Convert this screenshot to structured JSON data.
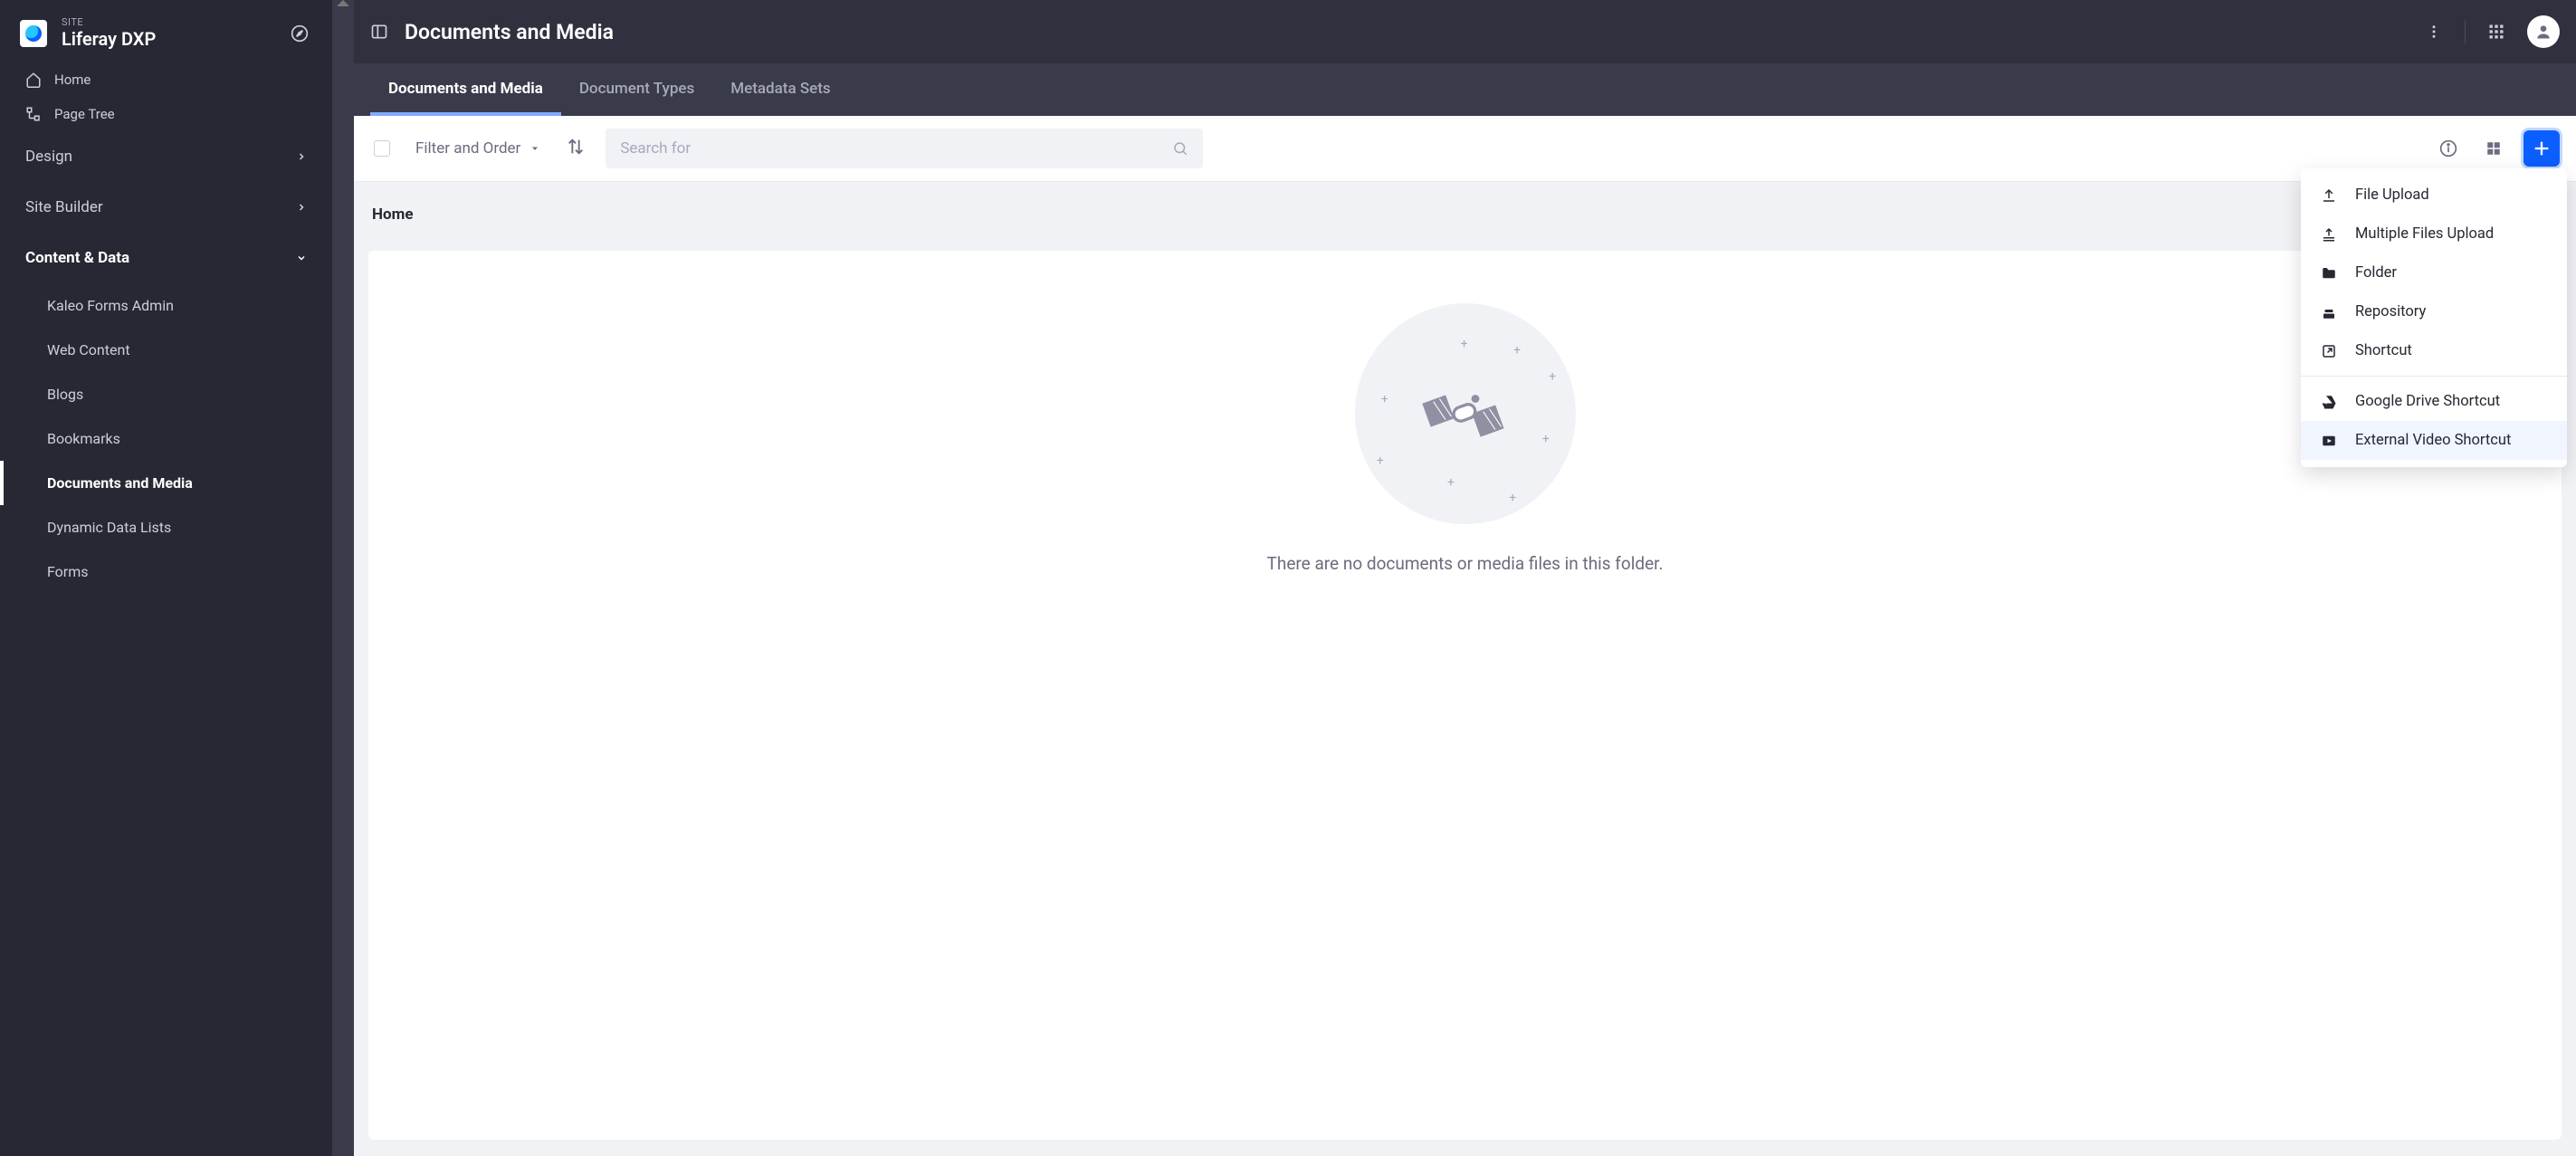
{
  "site": {
    "label": "SITE",
    "name": "Liferay DXP"
  },
  "sidebar": {
    "links": [
      {
        "label": "Home",
        "icon": "home-icon"
      },
      {
        "label": "Page Tree",
        "icon": "pagetree-icon"
      }
    ],
    "sections": [
      {
        "label": "Design",
        "expanded": false
      },
      {
        "label": "Site Builder",
        "expanded": false
      },
      {
        "label": "Content & Data",
        "expanded": true
      }
    ],
    "content_data_items": [
      {
        "label": "Kaleo Forms Admin",
        "active": false
      },
      {
        "label": "Web Content",
        "active": false
      },
      {
        "label": "Blogs",
        "active": false
      },
      {
        "label": "Bookmarks",
        "active": false
      },
      {
        "label": "Documents and Media",
        "active": true
      },
      {
        "label": "Dynamic Data Lists",
        "active": false
      },
      {
        "label": "Forms",
        "active": false
      }
    ]
  },
  "header": {
    "title": "Documents and Media"
  },
  "tabs": [
    {
      "label": "Documents and Media",
      "active": true
    },
    {
      "label": "Document Types",
      "active": false
    },
    {
      "label": "Metadata Sets",
      "active": false
    }
  ],
  "toolbar": {
    "filter_label": "Filter and Order",
    "search_placeholder": "Search for"
  },
  "breadcrumb": {
    "current": "Home"
  },
  "empty": {
    "message": "There are no documents or media files in this folder."
  },
  "add_menu": [
    {
      "label": "File Upload",
      "icon": "upload-icon"
    },
    {
      "label": "Multiple Files Upload",
      "icon": "upload-multi-icon"
    },
    {
      "label": "Folder",
      "icon": "folder-icon"
    },
    {
      "label": "Repository",
      "icon": "repository-icon"
    },
    {
      "label": "Shortcut",
      "icon": "shortcut-icon"
    },
    {
      "label": "Google Drive Shortcut",
      "icon": "gdrive-icon"
    },
    {
      "label": "External Video Shortcut",
      "icon": "video-icon",
      "hover": true
    }
  ]
}
